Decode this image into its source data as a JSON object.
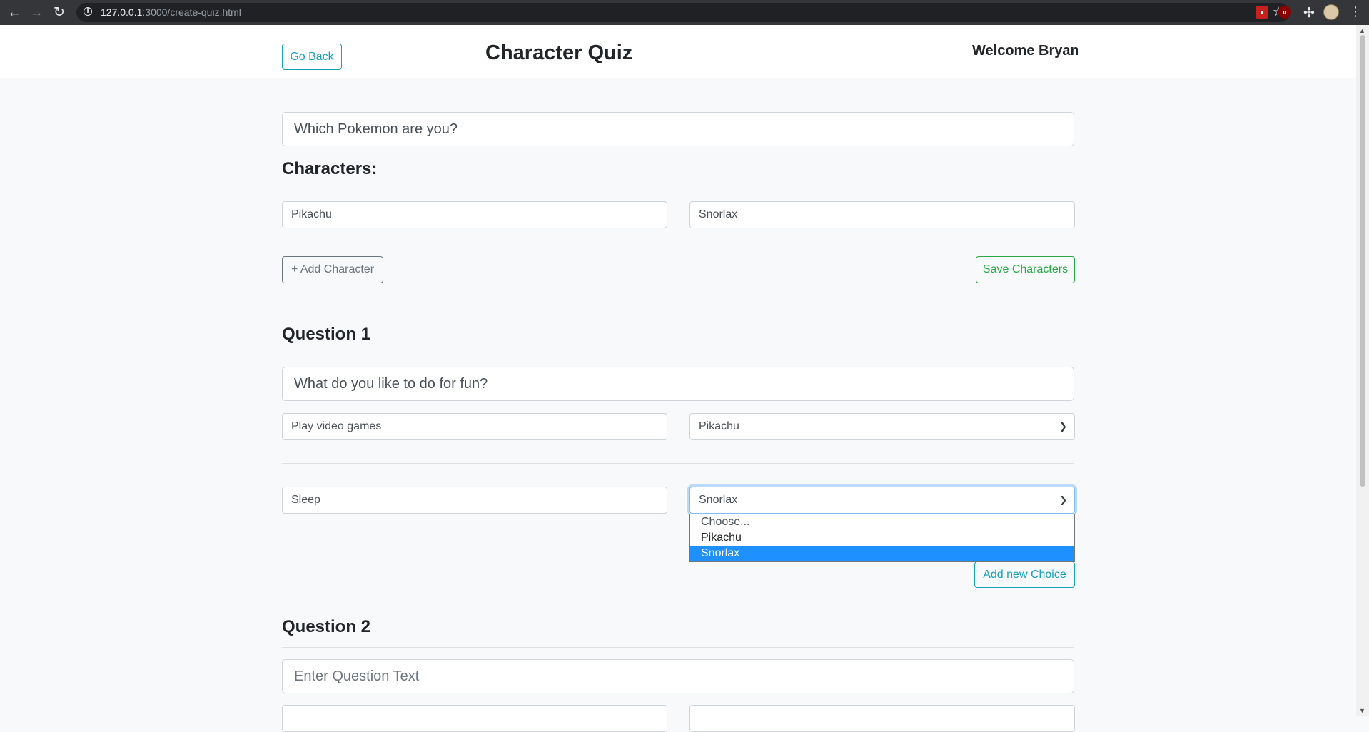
{
  "browser": {
    "url_host": "127.0.0.1",
    "url_rest": ":3000/create-quiz.html",
    "icons": [
      "back-arrow-icon",
      "forward-arrow-icon",
      "reload-icon",
      "site-info-icon",
      "star-icon",
      "extension-icon",
      "puzzle-icon",
      "profile-avatar",
      "menu-kebab-icon"
    ]
  },
  "header": {
    "go_back": "Go Back",
    "title": "Character Quiz",
    "welcome": "Welcome Bryan"
  },
  "quiz": {
    "title_value": "Which Pokemon are you?"
  },
  "characters": {
    "heading": "Characters:",
    "items": [
      "Pikachu",
      "Snorlax"
    ],
    "add_label": "+ Add Character",
    "save_label": "Save Characters"
  },
  "questions": [
    {
      "heading": "Question 1",
      "text": "What do you like to do for fun?",
      "choices": [
        {
          "text": "Play video games",
          "character": "Pikachu"
        },
        {
          "text": "Sleep",
          "character": "Snorlax"
        }
      ],
      "add_choice_label": "Add new Choice"
    },
    {
      "heading": "Question 2",
      "placeholder": "Enter Question Text"
    }
  ],
  "dropdown": {
    "options": [
      "Choose...",
      "Pikachu",
      "Snorlax"
    ],
    "selected": "Snorlax"
  },
  "colors": {
    "info": "#17a2b8",
    "success": "#28a745",
    "secondary": "#6c757d",
    "selected_option": "#1e90ff"
  }
}
